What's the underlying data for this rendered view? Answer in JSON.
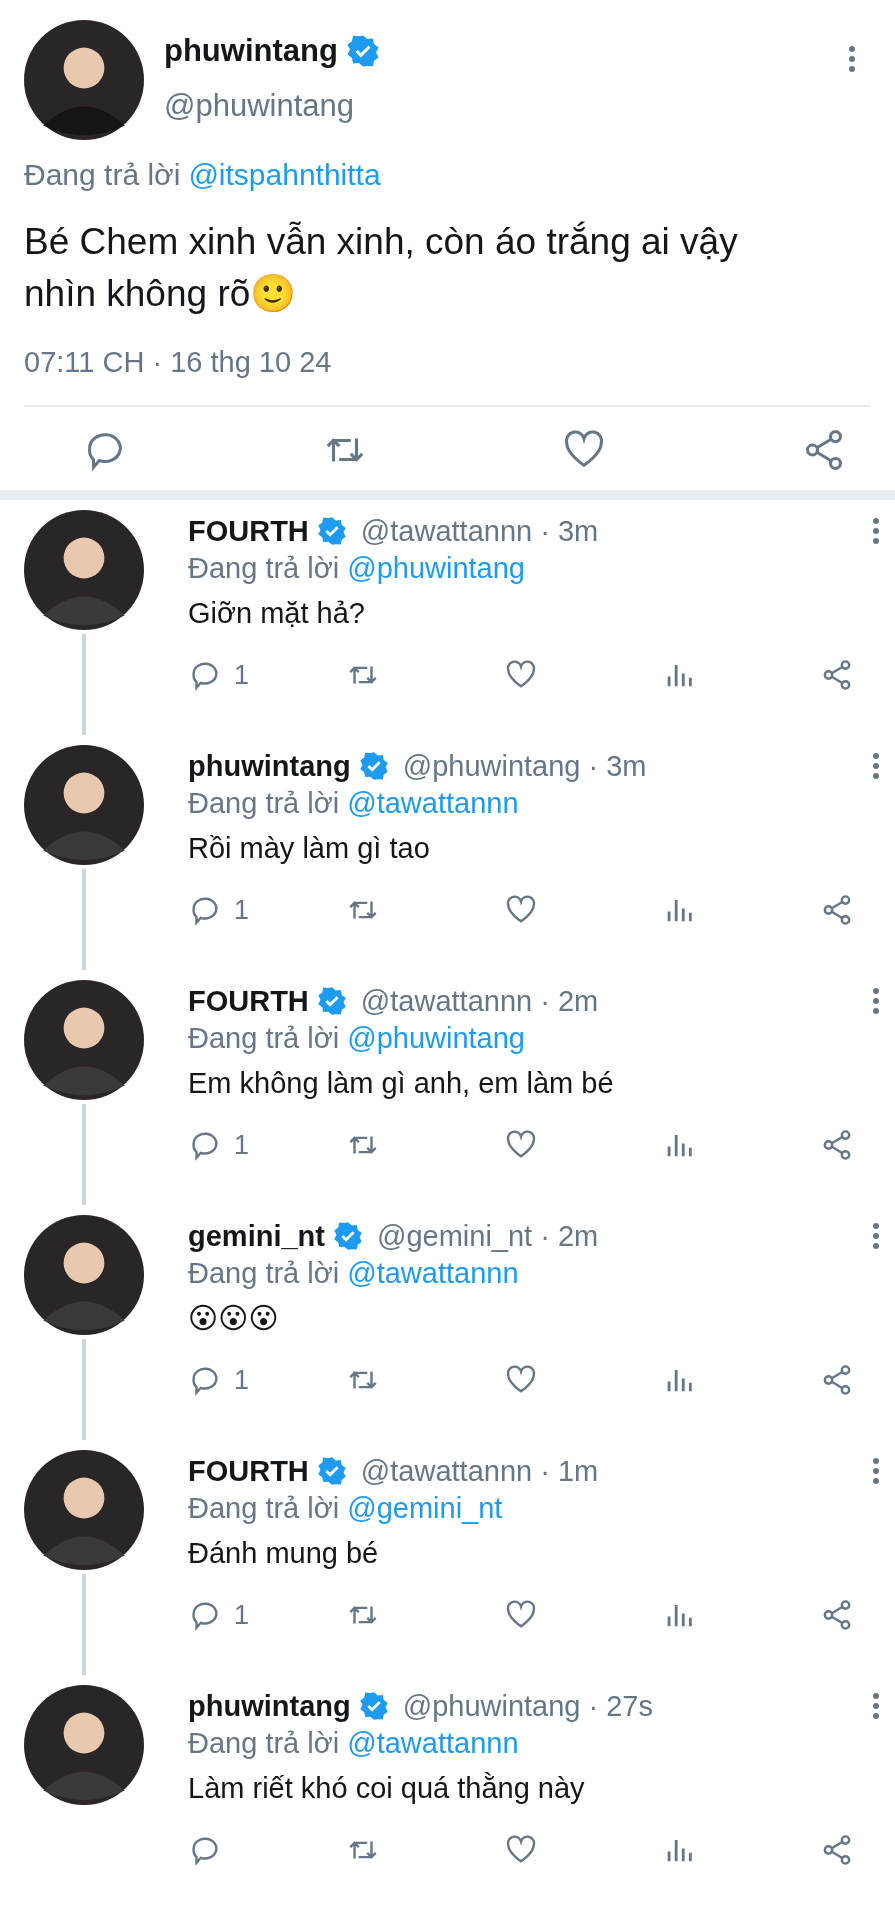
{
  "main_tweet": {
    "name": "phuwintang",
    "verified": true,
    "handle": "@phuwintang",
    "reply_prefix": "Đang trả lời",
    "reply_to": "@itspahnthitta",
    "text": "Bé Chem xinh vẫn xinh, còn áo trắng ai vậy nhìn không rõ🙂",
    "timestamp": "07:11 CH · 16 thg 10 24"
  },
  "replies": [
    {
      "name": "FOURTH",
      "verified": true,
      "handle": "@tawattannn · 3m",
      "reply_prefix": "Đang trả lời",
      "reply_to": "@phuwintang",
      "text": "Giỡn mặt hả?",
      "reply_count": "1"
    },
    {
      "name": "phuwintang",
      "verified": true,
      "handle": "@phuwintang · 3m",
      "reply_prefix": "Đang trả lời",
      "reply_to": "@tawattannn",
      "text": "Rồi mày làm gì tao",
      "reply_count": "1"
    },
    {
      "name": "FOURTH",
      "verified": true,
      "handle": "@tawattannn · 2m",
      "reply_prefix": "Đang trả lời",
      "reply_to": "@phuwintang",
      "text": "Em không làm gì anh, em làm bé",
      "reply_count": "1"
    },
    {
      "name": "gemini_nt",
      "verified": true,
      "handle": "@gemini_nt · 2m",
      "reply_prefix": "Đang trả lời",
      "reply_to": "@tawattannn",
      "text": "😮😮😮",
      "reply_count": "1"
    },
    {
      "name": "FOURTH",
      "verified": true,
      "handle": "@tawattannn · 1m",
      "reply_prefix": "Đang trả lời",
      "reply_to": "@gemini_nt",
      "text": "Đánh mung bé",
      "reply_count": "1"
    },
    {
      "name": "phuwintang",
      "verified": true,
      "handle": "@phuwintang · 27s",
      "reply_prefix": "Đang trả lời",
      "reply_to": "@tawattannn",
      "text": "Làm riết khó coi quá thằng này"
    }
  ]
}
